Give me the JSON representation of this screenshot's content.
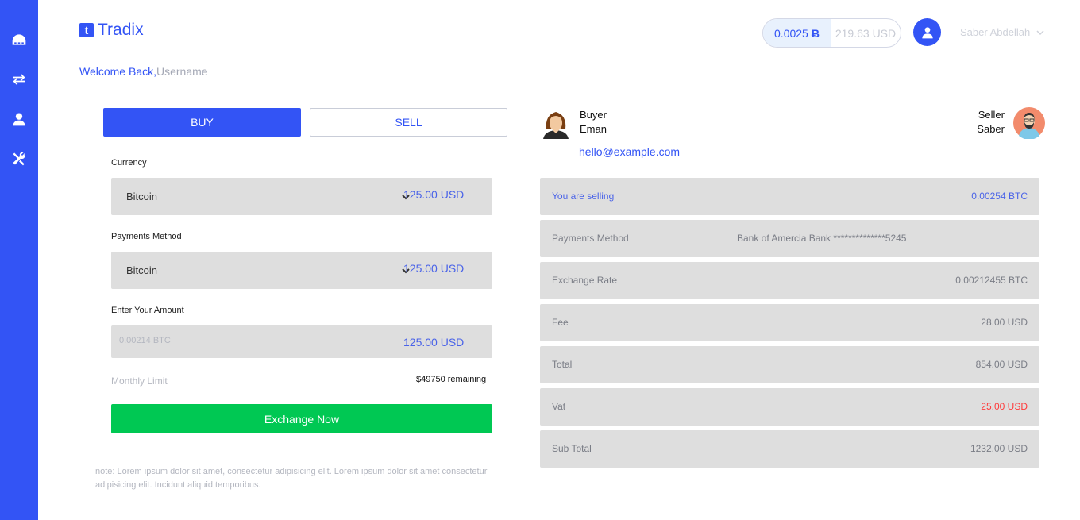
{
  "brand": {
    "name": "Tradix",
    "mark": "t"
  },
  "colors": {
    "accent": "#3354f5",
    "green": "#00c853",
    "red": "#ff3b3b",
    "panel": "#dedede"
  },
  "sidebar": {
    "items": [
      {
        "icon": "dashboard-icon"
      },
      {
        "icon": "exchange-icon"
      },
      {
        "icon": "user-icon"
      },
      {
        "icon": "tools-icon"
      }
    ]
  },
  "header": {
    "welcome": "Welcome Back,",
    "username_placeholder": "Username",
    "balance_btc": "0.0025",
    "btc_symbol": "Ƀ",
    "balance_usd": "219.63 USD",
    "user_name": "Saber Abdellah"
  },
  "trade": {
    "buy_label": "BUY",
    "sell_label": "SELL",
    "currency_label": "Currency",
    "currency_value": "Bitcoin",
    "currency_usd": "125.00 USD",
    "payment_label": "Payments Method",
    "payment_value": "Bitcoin",
    "payment_usd": "125.00 USD",
    "amount_label": "Enter Your Amount",
    "amount_placeholder": "0.00214 BTC",
    "amount_usd": "125.00 USD",
    "monthly_label": "Monthly Limit",
    "remaining": "$49750 remaining",
    "exchange_label": "Exchange Now",
    "note": "note: Lorem ipsum dolor sit amet, consectetur adipisicing elit. Lorem ipsum dolor sit amet consectetur adipisicing elit. Incidunt aliquid temporibus."
  },
  "parties": {
    "buyer_role": "Buyer",
    "buyer_name": "Eman",
    "email": "hello@example.com",
    "seller_role": "Seller",
    "seller_name": "Saber"
  },
  "summary": {
    "selling_label": "You are selling",
    "selling_value": "0.00254 BTC",
    "payment_label": "Payments Method",
    "payment_value": "Bank of Amercia Bank **************5245",
    "rate_label": "Exchange Rate",
    "rate_value": "0.00212455 BTC",
    "fee_label": "Fee",
    "fee_value": "28.00 USD",
    "total_label": "Total",
    "total_value": "854.00 USD",
    "vat_label": "Vat",
    "vat_value": "25.00 USD",
    "subtotal_label": "Sub Total",
    "subtotal_value": "1232.00 USD"
  }
}
